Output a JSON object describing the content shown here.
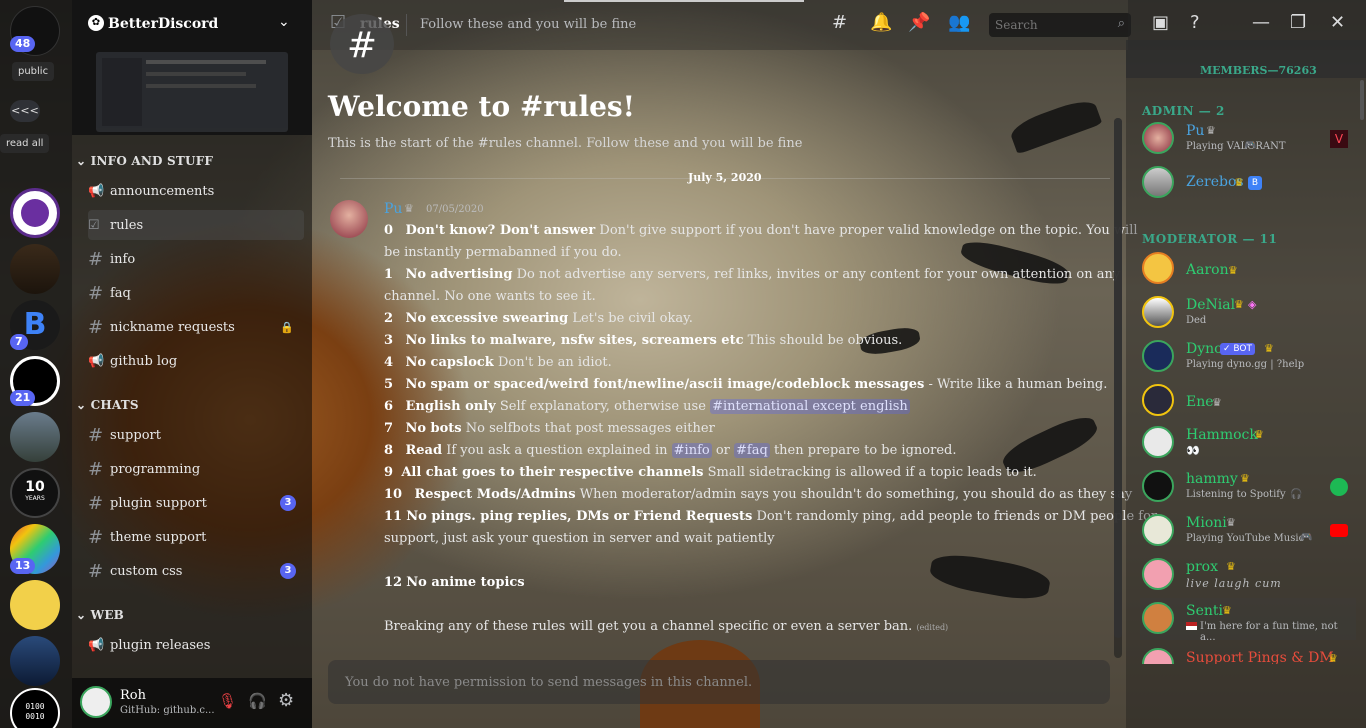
{
  "servers": {
    "home_badge": "48",
    "pill_public": "public",
    "collapse": "<<<",
    "read_all": "read all",
    "badges": [
      "7",
      "21",
      "13"
    ],
    "anniversary": [
      "10",
      "YEARS"
    ],
    "binary": [
      "0100",
      "0010"
    ]
  },
  "guild": {
    "name": "BetterDiscord",
    "categories": [
      {
        "label": "INFO AND STUFF"
      },
      {
        "label": "CHATS"
      },
      {
        "label": "WEB"
      }
    ],
    "channels": [
      {
        "label": "announcements",
        "icon": "megaphone-icon"
      },
      {
        "label": "rules",
        "icon": "checkbox-icon"
      },
      {
        "label": "info",
        "icon": "hash-icon"
      },
      {
        "label": "faq",
        "icon": "hash-icon"
      },
      {
        "label": "nickname requests",
        "icon": "hash-icon"
      },
      {
        "label": "github log",
        "icon": "megaphone-icon"
      },
      {
        "label": "support",
        "icon": "hash-icon"
      },
      {
        "label": "programming",
        "icon": "hash-icon"
      },
      {
        "label": "plugin support",
        "icon": "hash-icon",
        "count": "3"
      },
      {
        "label": "theme support",
        "icon": "hash-icon"
      },
      {
        "label": "custom css",
        "icon": "hash-icon",
        "count": "3"
      },
      {
        "label": "plugin releases",
        "icon": "megaphone-icon"
      }
    ]
  },
  "user": {
    "name": "Roh",
    "status": "GitHub: github.c..."
  },
  "header": {
    "channel": "rules",
    "topic": "Follow these and you will be fine",
    "search_placeholder": "Search"
  },
  "welcome": {
    "title": "Welcome to #rules!",
    "subtitle": "This is the start of the #rules channel. Follow these and you will be fine",
    "date": "July 5, 2020"
  },
  "message": {
    "author": "Pu",
    "timestamp": "07/05/2020",
    "rules": [
      {
        "num": "0",
        "title": "Don't know? Don't answer",
        "text": "Don't give support if you don't have proper valid knowledge on the topic. You will",
        "cont": "be instantly permabanned if you do."
      },
      {
        "num": "1",
        "title": "No advertising",
        "text": "Do not advertise any servers, ref links, invites or any content for your own attention on any",
        "cont": "channel. No one wants to see it."
      },
      {
        "num": "2",
        "title": "No excessive swearing",
        "text": "Let's be civil okay."
      },
      {
        "num": "3",
        "title": "No links to malware, nsfw sites, screamers etc",
        "text": "This should be obvious."
      },
      {
        "num": "4",
        "title": "No capslock",
        "text": "Don't be an idiot."
      },
      {
        "num": "5",
        "title": "No spam or spaced/weird font/newline/ascii image/codeblock messages",
        "text": "- Write like a human being."
      },
      {
        "num": "6",
        "title": "English only",
        "text": "Self explanatory, otherwise use",
        "mention": "#international except english"
      },
      {
        "num": "7",
        "title": "No bots",
        "text": "No selfbots that post messages either"
      },
      {
        "num": "8",
        "title": "Read",
        "text": "If you ask a question explained in",
        "mention": "#info",
        "mid": "or",
        "mention2": "#faq",
        "after": "then prepare to be ignored."
      },
      {
        "num": "9",
        "title": "All chat goes to their respective channels",
        "text": "Small sidetracking is allowed if a topic leads to it."
      },
      {
        "num": "10",
        "title": "Respect Mods/Admins",
        "text": "When moderator/admin says you shouldn't do something, you should do as they say"
      },
      {
        "num": "11",
        "title": "No pings. ping replies, DMs or Friend Requests",
        "text": "Don't randomly ping, add people to friends or DM people for",
        "cont": "support, just ask your question in server and wait patiently"
      },
      {
        "num": "12",
        "title": "No anime topics",
        "text": ""
      }
    ],
    "footer": "Breaking any of these rules will get you a channel specific or even a server ban.",
    "edited": "(edited)"
  },
  "composer": {
    "placeholder": "You do not have permission to send messages in this channel."
  },
  "members": {
    "header": "MEMBERS—76263",
    "sections": [
      {
        "label": "ADMIN — 2"
      },
      {
        "label": "MODERATOR — 11"
      }
    ],
    "list": [
      {
        "name": "Pu",
        "status": "Playing VALORANT",
        "color": "#4aa3df"
      },
      {
        "name": "Zerebos",
        "status": "",
        "color": "#4aa3df"
      },
      {
        "name": "Aaron",
        "status": "",
        "color": "#2ecc71"
      },
      {
        "name": "DeNial",
        "status": "Ded",
        "color": "#2ecc71"
      },
      {
        "name": "Dyno",
        "bot": "BOT",
        "status": "Playing dyno.gg | ?help",
        "color": "#2ecc71"
      },
      {
        "name": "Ene",
        "status": "",
        "color": "#2ecc71"
      },
      {
        "name": "Hammock",
        "status": "",
        "color": "#2ecc71"
      },
      {
        "name": "hammy",
        "status": "Listening to Spotify",
        "color": "#2ecc71"
      },
      {
        "name": "Mioni",
        "status": "Playing YouTube Music",
        "color": "#2ecc71"
      },
      {
        "name": "prox",
        "status": "live laugh cum",
        "color": "#2ecc71"
      },
      {
        "name": "Senti",
        "status": "I'm here for a fun time, not a...",
        "color": "#2ecc71"
      },
      {
        "name": "Support Pings & DM",
        "status": "",
        "color": "#e74c3c"
      }
    ]
  }
}
